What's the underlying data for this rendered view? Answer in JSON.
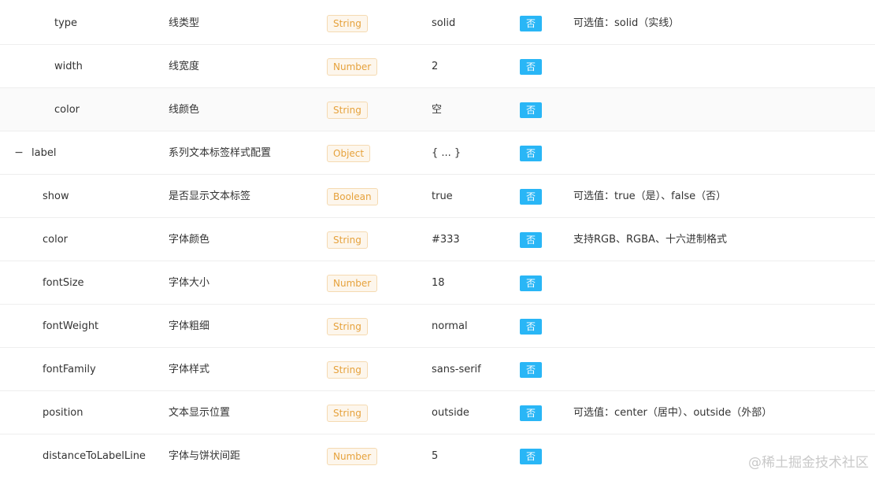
{
  "rows": [
    {
      "name": "type",
      "level": 2,
      "desc": "线类型",
      "type": "String",
      "default": "solid",
      "required": "否",
      "note": "可选值：solid（实线）"
    },
    {
      "name": "width",
      "level": 2,
      "desc": "线宽度",
      "type": "Number",
      "default": "2",
      "required": "否",
      "note": ""
    },
    {
      "name": "color",
      "level": 2,
      "desc": "线颜色",
      "type": "String",
      "default": "空",
      "required": "否",
      "note": ""
    },
    {
      "name": "label",
      "level": 0,
      "toggle": "−",
      "desc": "系列文本标签样式配置",
      "type": "Object",
      "default": "{ ... }",
      "required": "否",
      "note": ""
    },
    {
      "name": "show",
      "level": 1,
      "desc": "是否显示文本标签",
      "type": "Boolean",
      "default": "true",
      "required": "否",
      "note": "可选值：true（是）、false（否）"
    },
    {
      "name": "color",
      "level": 1,
      "desc": "字体颜色",
      "type": "String",
      "default": "#333",
      "required": "否",
      "note": "支持RGB、RGBA、十六进制格式"
    },
    {
      "name": "fontSize",
      "level": 1,
      "desc": "字体大小",
      "type": "Number",
      "default": "18",
      "required": "否",
      "note": ""
    },
    {
      "name": "fontWeight",
      "level": 1,
      "desc": "字体粗细",
      "type": "String",
      "default": "normal",
      "required": "否",
      "note": ""
    },
    {
      "name": "fontFamily",
      "level": 1,
      "desc": "字体样式",
      "type": "String",
      "default": "sans-serif",
      "required": "否",
      "note": ""
    },
    {
      "name": "position",
      "level": 1,
      "desc": "文本显示位置",
      "type": "String",
      "default": "outside",
      "required": "否",
      "note": "可选值：center（居中）、outside（外部）"
    },
    {
      "name": "distanceToLabelLine",
      "level": 1,
      "desc": "字体与饼状间距",
      "type": "Number",
      "default": "5",
      "required": "否",
      "note": ""
    }
  ],
  "watermark": "@稀土掘金技术社区",
  "colors": {
    "type_tag_text": "#e6a23c",
    "type_tag_bg": "#fdf6ec",
    "type_tag_border": "#f5dab1",
    "required_tag_bg": "#29b6f6",
    "hover_row_bg": "#fafafa"
  }
}
